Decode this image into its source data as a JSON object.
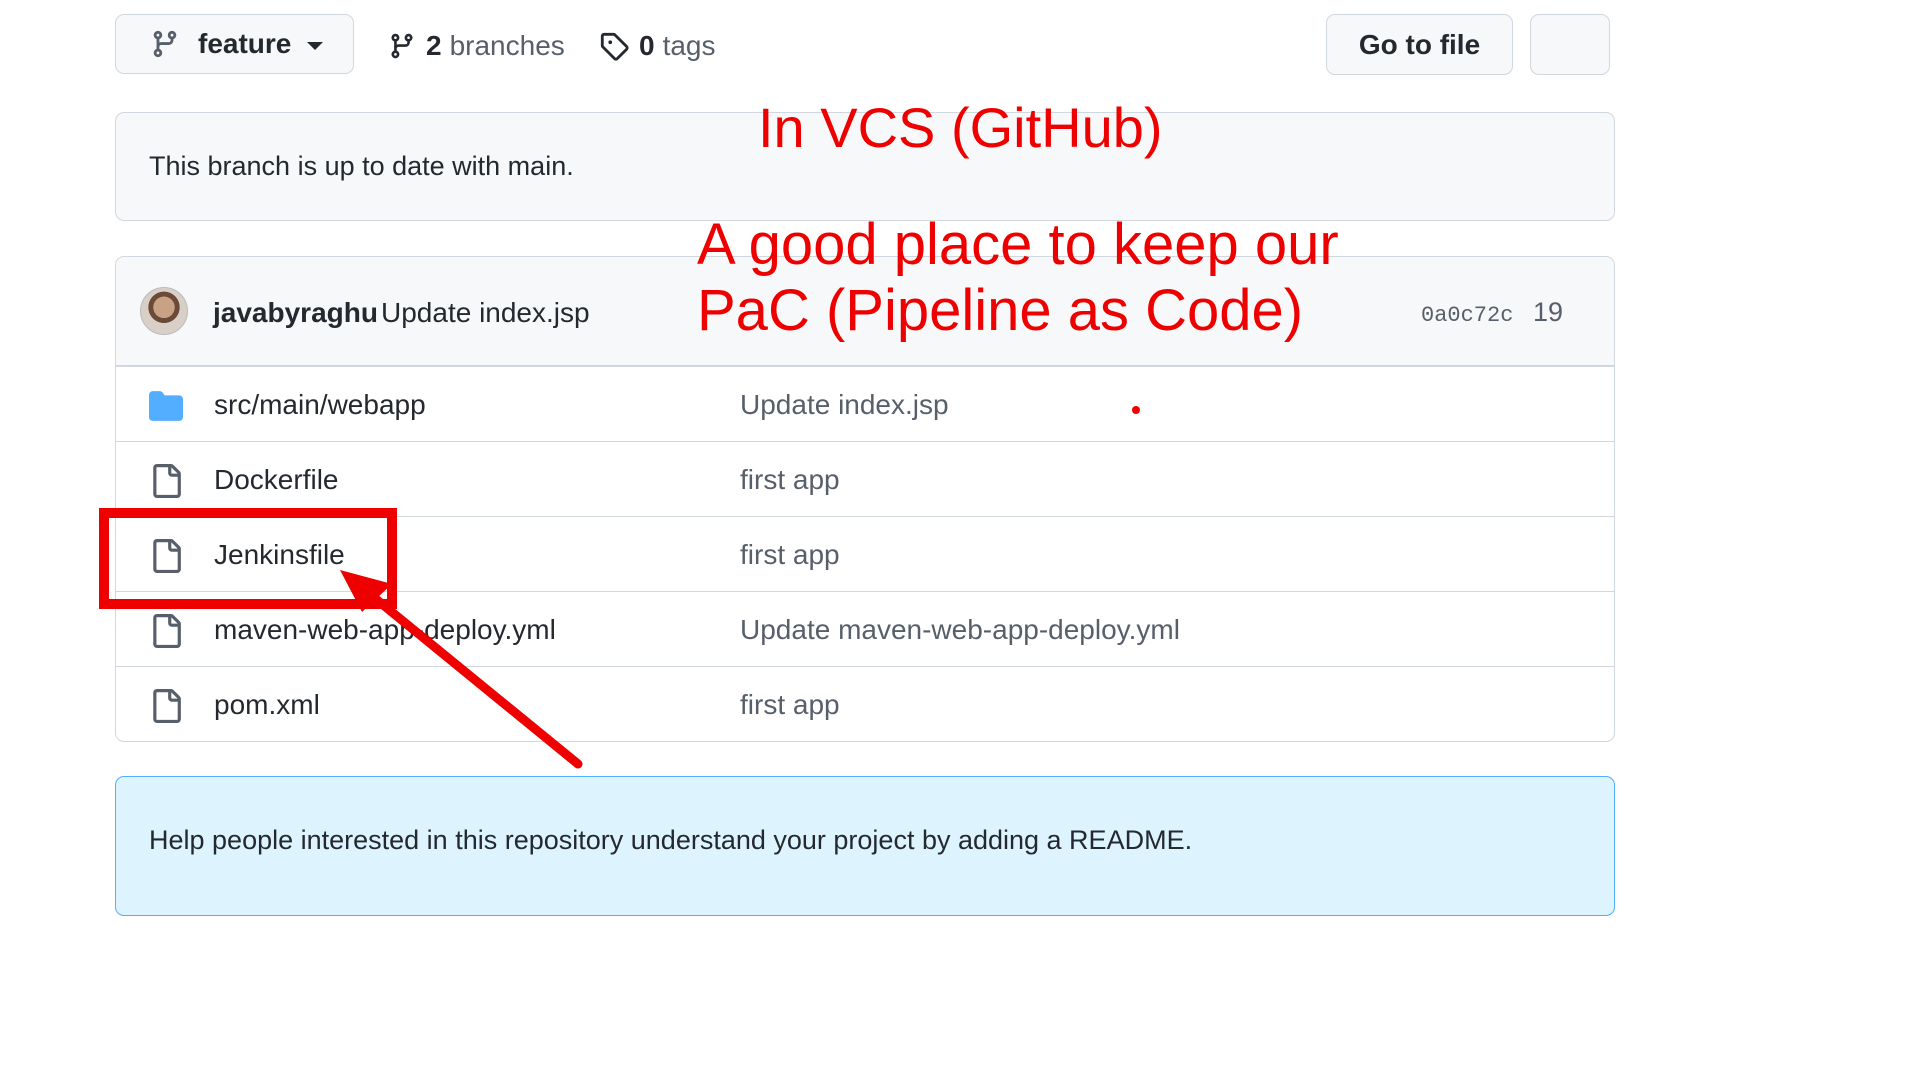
{
  "toolbar": {
    "branch_label": "feature",
    "branches_count": "2",
    "branches_label": "branches",
    "tags_count": "0",
    "tags_label": "tags",
    "go_to_file_label": "Go to file"
  },
  "branch_status": "This branch is up to date with main.",
  "latest_commit": {
    "author": "javabyraghu",
    "message": "Update index.jsp",
    "sha": "0a0c72c",
    "age": "19"
  },
  "files": [
    {
      "type": "folder",
      "name": "src/main/webapp",
      "message": "Update index.jsp"
    },
    {
      "type": "file",
      "name": "Dockerfile",
      "message": "first app"
    },
    {
      "type": "file",
      "name": "Jenkinsfile",
      "message": "first app"
    },
    {
      "type": "file",
      "name": "maven-web-app-deploy.yml",
      "message": "Update maven-web-app-deploy.yml"
    },
    {
      "type": "file",
      "name": "pom.xml",
      "message": "first app"
    }
  ],
  "readme_prompt": "Help people interested in this repository understand your project by adding a README.",
  "annotations": {
    "title": "In VCS (GitHub)",
    "line1": "A good place to keep our",
    "line2": "PaC (Pipeline as Code)",
    "color": "#ee0000"
  },
  "colors": {
    "border": "#d0d7de",
    "folder": "#54aeff",
    "readme_bg": "#ddf4ff"
  }
}
